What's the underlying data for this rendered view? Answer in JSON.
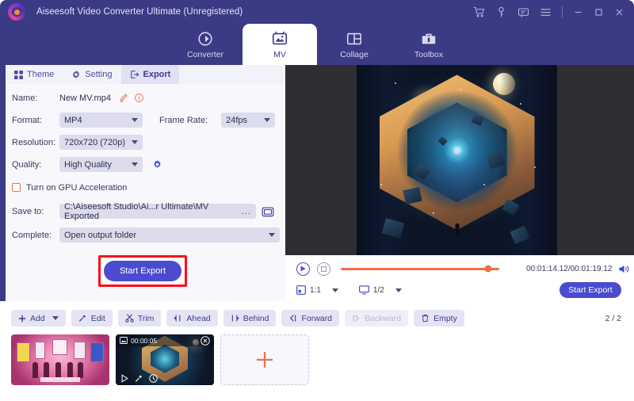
{
  "window": {
    "title": "Aiseesoft Video Converter Ultimate (Unregistered)",
    "icons": [
      "cart-icon",
      "key-icon",
      "feedback-icon",
      "menu-icon"
    ],
    "controls": [
      "minimize-button",
      "maximize-button",
      "close-button"
    ],
    "accent": "#3b3a85"
  },
  "nav": {
    "tabs": [
      {
        "label": "Converter",
        "icon": "converter-icon",
        "active": false
      },
      {
        "label": "MV",
        "icon": "mv-icon",
        "active": true
      },
      {
        "label": "Collage",
        "icon": "collage-icon",
        "active": false
      },
      {
        "label": "Toolbox",
        "icon": "toolbox-icon",
        "active": false
      }
    ]
  },
  "subtabs": {
    "items": [
      {
        "label": "Theme",
        "icon": "grid-icon",
        "active": false
      },
      {
        "label": "Setting",
        "icon": "gear-icon",
        "active": false
      },
      {
        "label": "Export",
        "icon": "export-icon",
        "active": true
      }
    ]
  },
  "export_form": {
    "name_label": "Name:",
    "name_value": "New MV.mp4",
    "format_label": "Format:",
    "format_value": "MP4",
    "frame_rate_label": "Frame Rate:",
    "frame_rate_value": "24fps",
    "resolution_label": "Resolution:",
    "resolution_value": "720x720 (720p)",
    "quality_label": "Quality:",
    "quality_value": "High Quality",
    "gpu_label": "Turn on GPU Acceleration",
    "gpu_checked": false,
    "save_to_label": "Save to:",
    "save_to_value": "C:\\Aiseesoft Studio\\Ai...r Ultimate\\MV Exported",
    "browse_label": "...",
    "complete_label": "Complete:",
    "complete_value": "Open output folder",
    "start_export_label": "Start Export",
    "highlight_color": "#fc0d1b"
  },
  "player": {
    "play_icon": "play-icon",
    "stop_icon": "stop-icon",
    "time": "00:01:14.12/00:01:19.12",
    "volume_icon": "volume-icon",
    "progress_percent": 93,
    "aspect_ratio": "1:1",
    "zoom_level": "1/2",
    "start_export_label": "Start Export"
  },
  "toolbar": {
    "buttons": [
      {
        "label": "Add",
        "icon": "plus-icon",
        "dropdown": true,
        "disabled": false
      },
      {
        "label": "Edit",
        "icon": "magic-wand-icon",
        "dropdown": false,
        "disabled": false
      },
      {
        "label": "Trim",
        "icon": "scissors-icon",
        "dropdown": false,
        "disabled": false
      },
      {
        "label": "Ahead",
        "icon": "insert-ahead-icon",
        "dropdown": false,
        "disabled": false
      },
      {
        "label": "Behind",
        "icon": "insert-behind-icon",
        "dropdown": false,
        "disabled": false
      },
      {
        "label": "Forward",
        "icon": "move-forward-icon",
        "dropdown": false,
        "disabled": false
      },
      {
        "label": "Backward",
        "icon": "move-backward-icon",
        "dropdown": false,
        "disabled": true
      },
      {
        "label": "Empty",
        "icon": "trash-icon",
        "dropdown": false,
        "disabled": false
      }
    ],
    "counter": "2 / 2"
  },
  "filmstrip": {
    "clips": [
      {
        "name": "gallery-clip",
        "duration": "",
        "selected": false
      },
      {
        "name": "cosmic-clip",
        "duration": "00:00:05",
        "selected": true
      }
    ],
    "add_tile_label": "+"
  }
}
